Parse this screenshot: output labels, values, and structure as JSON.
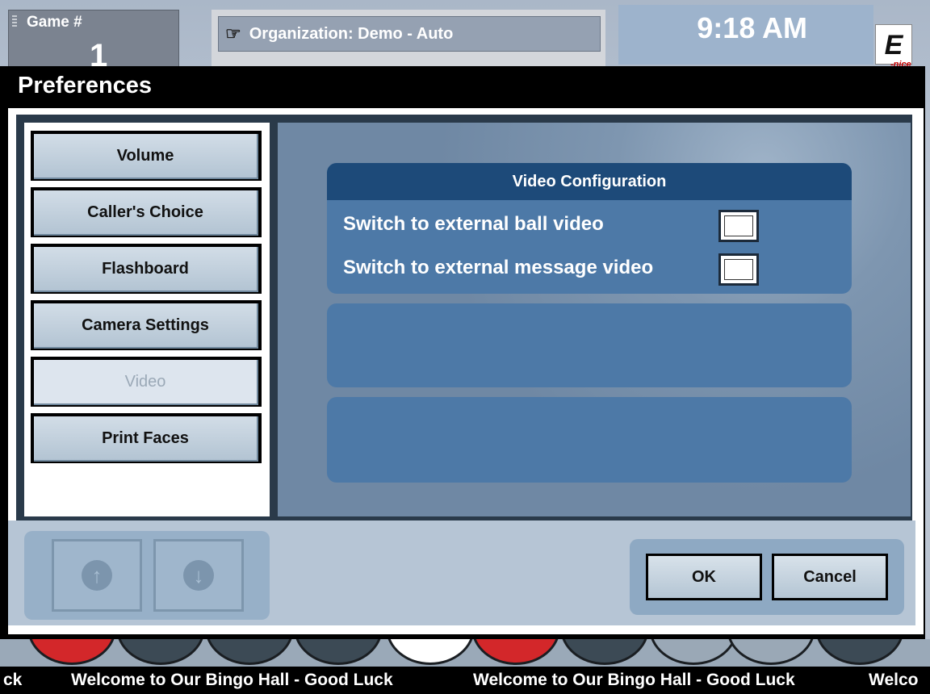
{
  "header": {
    "game_label": "Game #",
    "game_number": "1",
    "organization": "Organization: Demo - Auto",
    "time": "9:18 AM",
    "logo_text": "E",
    "logo_sub": "-nice"
  },
  "dialog": {
    "title": "Preferences",
    "nav_items": [
      {
        "label": "Volume",
        "selected": false
      },
      {
        "label": "Caller's Choice",
        "selected": false
      },
      {
        "label": "Flashboard",
        "selected": false
      },
      {
        "label": "Camera Settings",
        "selected": false
      },
      {
        "label": "Video",
        "selected": true
      },
      {
        "label": "Print Faces",
        "selected": false
      }
    ],
    "video_config": {
      "title": "Video Configuration",
      "options": [
        {
          "label": "Switch to external ball video",
          "checked": false
        },
        {
          "label": "Switch to external message video",
          "checked": false
        }
      ]
    },
    "buttons": {
      "ok": "OK",
      "cancel": "Cancel"
    },
    "scroll_icons": [
      "arrow-up-icon",
      "arrow-down-icon"
    ]
  },
  "ticker": {
    "fragment_start": "ck",
    "message": "Welcome to Our Bingo Hall - Good Luck",
    "fragment_end": "Welco"
  },
  "ball_colors": [
    "#d3272a",
    "#3c4a55",
    "#3c4a55",
    "#3c4a55",
    "#ffffff",
    "#d3272a",
    "#3c4a55",
    "#9aa8b6",
    "#9aa8b6",
    "#3c4a55"
  ]
}
